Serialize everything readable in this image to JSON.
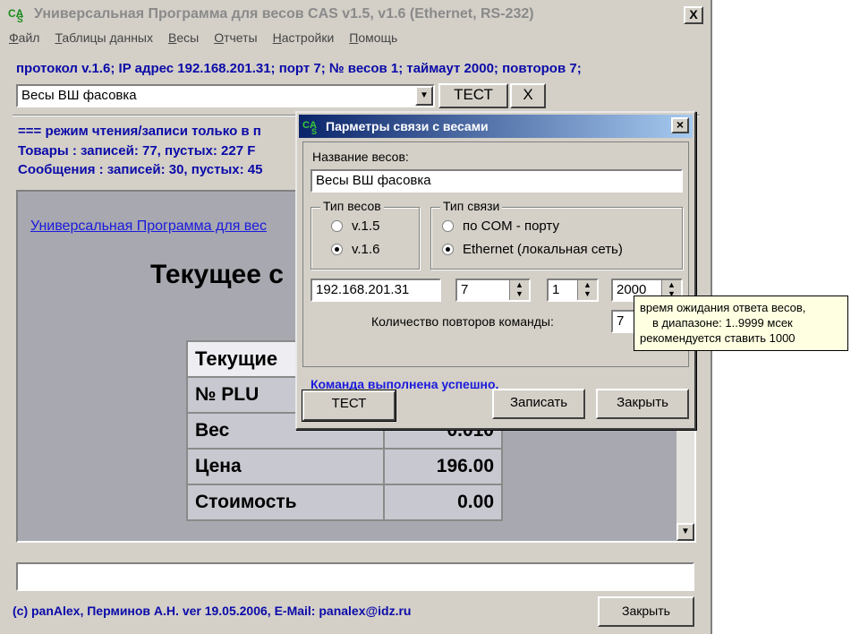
{
  "app": {
    "title": "Универсальная Программа для весов CAS v1.5, v1.6 (Ethernet, RS-232)",
    "close_label": "X"
  },
  "menu": [
    "Файл",
    "Таблицы данных",
    "Весы",
    "Отчеты",
    "Настройки",
    "Помощь"
  ],
  "protocol_line": "протокол v.1.6; IP адрес 192.168.201.31; порт 7; № весов 1; таймаут 2000; повторов 7;",
  "scale_select": {
    "value": "Весы ВШ фасовка"
  },
  "toolbar": {
    "test_label": "ТЕСТ",
    "x_label": "X"
  },
  "info": {
    "mode": "=== режим чтения/записи только в п",
    "goods": "Товары : записей: 77, пустых: 227  F",
    "messages": "Сообщения : записей: 30, пустых: 45"
  },
  "panel": {
    "link": "Универсальная Программа для вес",
    "current_title": "Текущее с",
    "table": {
      "header": "Текущие",
      "rows": [
        {
          "label": "№ PLU",
          "value": ""
        },
        {
          "label": "Вес",
          "value": "0.010"
        },
        {
          "label": "Цена",
          "value": "196.00"
        },
        {
          "label": "Стоимость",
          "value": "0.00"
        }
      ]
    }
  },
  "footer": {
    "copyright": "(c) panAlex, Перминов А.Н. ver 19.05.2006, E-Mail: panalex@idz.ru",
    "close_label": "Закрыть"
  },
  "dialog": {
    "title": "Парметры связи с весами",
    "name_label": "Название весов:",
    "name_value": "Весы ВШ фасовка",
    "scale_type": {
      "title": "Тип весов",
      "options": [
        {
          "label": "v.1.5",
          "checked": false
        },
        {
          "label": "v.1.6",
          "checked": true
        }
      ]
    },
    "conn_type": {
      "title": "Тип связи",
      "options": [
        {
          "label": "по COM - порту",
          "checked": false
        },
        {
          "label": "Ethernet (локальная сеть)",
          "checked": true
        }
      ]
    },
    "ip": "192.168.201.31",
    "port": "7",
    "scale_num": "1",
    "timeout": "2000",
    "retries_label": "Количество повторов команды:",
    "retries": "7",
    "status": "Команда выполнена успешно.",
    "test_label": "ТЕСТ",
    "write_label": "Записать",
    "close_label": "Закрыть"
  },
  "tooltip": {
    "line1": "время ожидания ответа весов,",
    "line2": "в диапазоне: 1..9999 мсек",
    "line3": "рекомендуется ставить 1000"
  },
  "colors": {
    "accent_text": "#0a0aa8",
    "dialog_title_start": "#0a246a",
    "dialog_title_end": "#a6caf0",
    "panel_bg": "#a8a8b0"
  }
}
